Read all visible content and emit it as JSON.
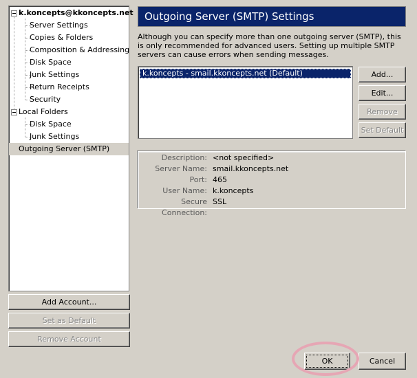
{
  "tree": {
    "account": "k.koncepts@kkoncepts.net",
    "account_items": [
      "Server Settings",
      "Copies & Folders",
      "Composition & Addressing",
      "Disk Space",
      "Junk Settings",
      "Return Receipts",
      "Security"
    ],
    "local_folders": "Local Folders",
    "local_items": [
      "Disk Space",
      "Junk Settings"
    ],
    "outgoing": "Outgoing Server (SMTP)"
  },
  "left_buttons": {
    "add_account": "Add Account...",
    "set_default": "Set as Default",
    "remove_account": "Remove Account"
  },
  "panel": {
    "title": "Outgoing Server (SMTP) Settings",
    "description": "Although you can specify more than one outgoing server (SMTP), this is only recommended for advanced users. Setting up multiple SMTP servers can cause errors when sending messages.",
    "servers": [
      "k.koncepts - smail.kkoncepts.net (Default)"
    ],
    "buttons": {
      "add": "Add...",
      "edit": "Edit...",
      "remove": "Remove",
      "set_default": "Set Default"
    },
    "details": {
      "description_label": "Description:",
      "description_value": "<not specified>",
      "server_name_label": "Server Name:",
      "server_name_value": "smail.kkoncepts.net",
      "port_label": "Port:",
      "port_value": "465",
      "user_name_label": "User Name:",
      "user_name_value": "k.koncepts",
      "secure_label": "Secure Connection:",
      "secure_value": "SSL"
    }
  },
  "dialog": {
    "ok": "OK",
    "cancel": "Cancel"
  },
  "colors": {
    "selection": "#0a246a",
    "face": "#d4d0c8",
    "highlight_ring": "#e6a6b4"
  }
}
